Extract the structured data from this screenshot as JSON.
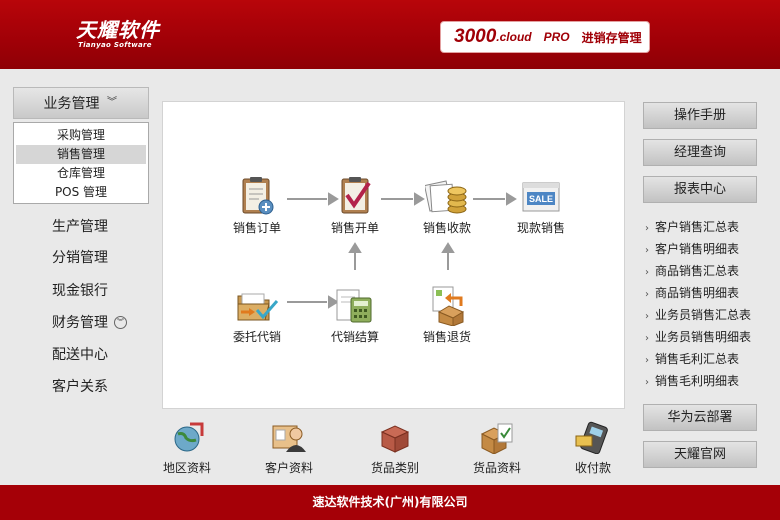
{
  "header": {
    "logo_main": "天耀软件",
    "logo_sub": "Tianyao Software",
    "product_num": "3000",
    "product_cloud": ".cloud",
    "product_pro": "PRO",
    "product_name": "进销存管理"
  },
  "left_nav": {
    "top_label": "业务管理",
    "sub_items": [
      "采购管理",
      "销售管理",
      "仓库管理",
      "POS 管理"
    ],
    "items": [
      "生产管理",
      "分销管理",
      "现金银行",
      "财务管理",
      "配送中心",
      "客户关系"
    ]
  },
  "flow": {
    "sales_order": "销售订单",
    "sales_invoice": "销售开单",
    "sales_receipt": "销售收款",
    "cash_sale": "现款销售",
    "consignment": "委托代销",
    "consign_settle": "代销结算",
    "sales_return": "销售退货"
  },
  "bottom_bar": [
    "地区资料",
    "客户资料",
    "货品类别",
    "货品资料",
    "收付款"
  ],
  "right_panel": {
    "manual": "操作手册",
    "manager_query": "经理查询",
    "report_center": "报表中心",
    "reports": [
      "客户销售汇总表",
      "客户销售明细表",
      "商品销售汇总表",
      "商品销售明细表",
      "业务员销售汇总表",
      "业务员销售明细表",
      "销售毛利汇总表",
      "销售毛利明细表"
    ],
    "huawei_cloud": "华为云部署",
    "official_site": "天耀官网"
  },
  "footer": "速达软件技术(广州)有限公司",
  "icons": {
    "sales_order": "clipboard-plus-icon",
    "sales_invoice": "clipboard-check-icon",
    "sales_receipt": "coins-papers-icon",
    "cash_sale": "sale-tag-icon",
    "consignment": "folder-check-icon",
    "consign_settle": "calculator-icon",
    "sales_return": "return-box-icon"
  },
  "colors": {
    "brand_red": "#a00007",
    "panel_bg": "#ffffff",
    "page_bg": "#e9e9e9"
  }
}
